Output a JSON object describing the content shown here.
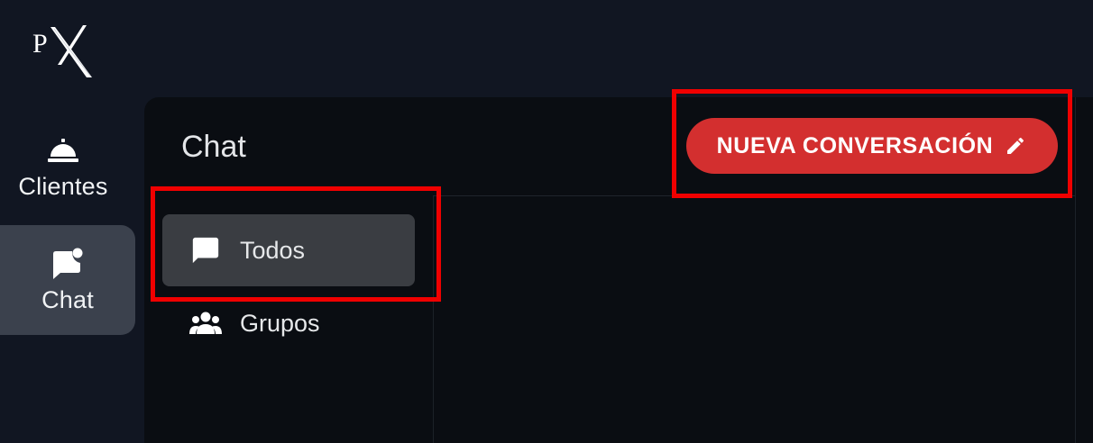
{
  "app": {
    "logo_text": "PX"
  },
  "nav": {
    "items": [
      {
        "label": "Clientes",
        "icon": "service-bell-icon",
        "active": false
      },
      {
        "label": "Chat",
        "icon": "chat-notification-icon",
        "active": true
      }
    ]
  },
  "chat": {
    "title": "Chat",
    "new_conversation_label": "NUEVA CONVERSACIÓN",
    "new_conversation_icon": "pencil-icon",
    "filters": [
      {
        "label": "Todos",
        "icon": "chat-bubble-icon",
        "selected": true
      },
      {
        "label": "Grupos",
        "icon": "group-icon",
        "selected": false
      }
    ]
  },
  "colors": {
    "accent": "#d32f2f",
    "highlight": "#f00000",
    "nav_active_bg": "#3b414d",
    "filter_selected_bg": "#3a3d42"
  }
}
